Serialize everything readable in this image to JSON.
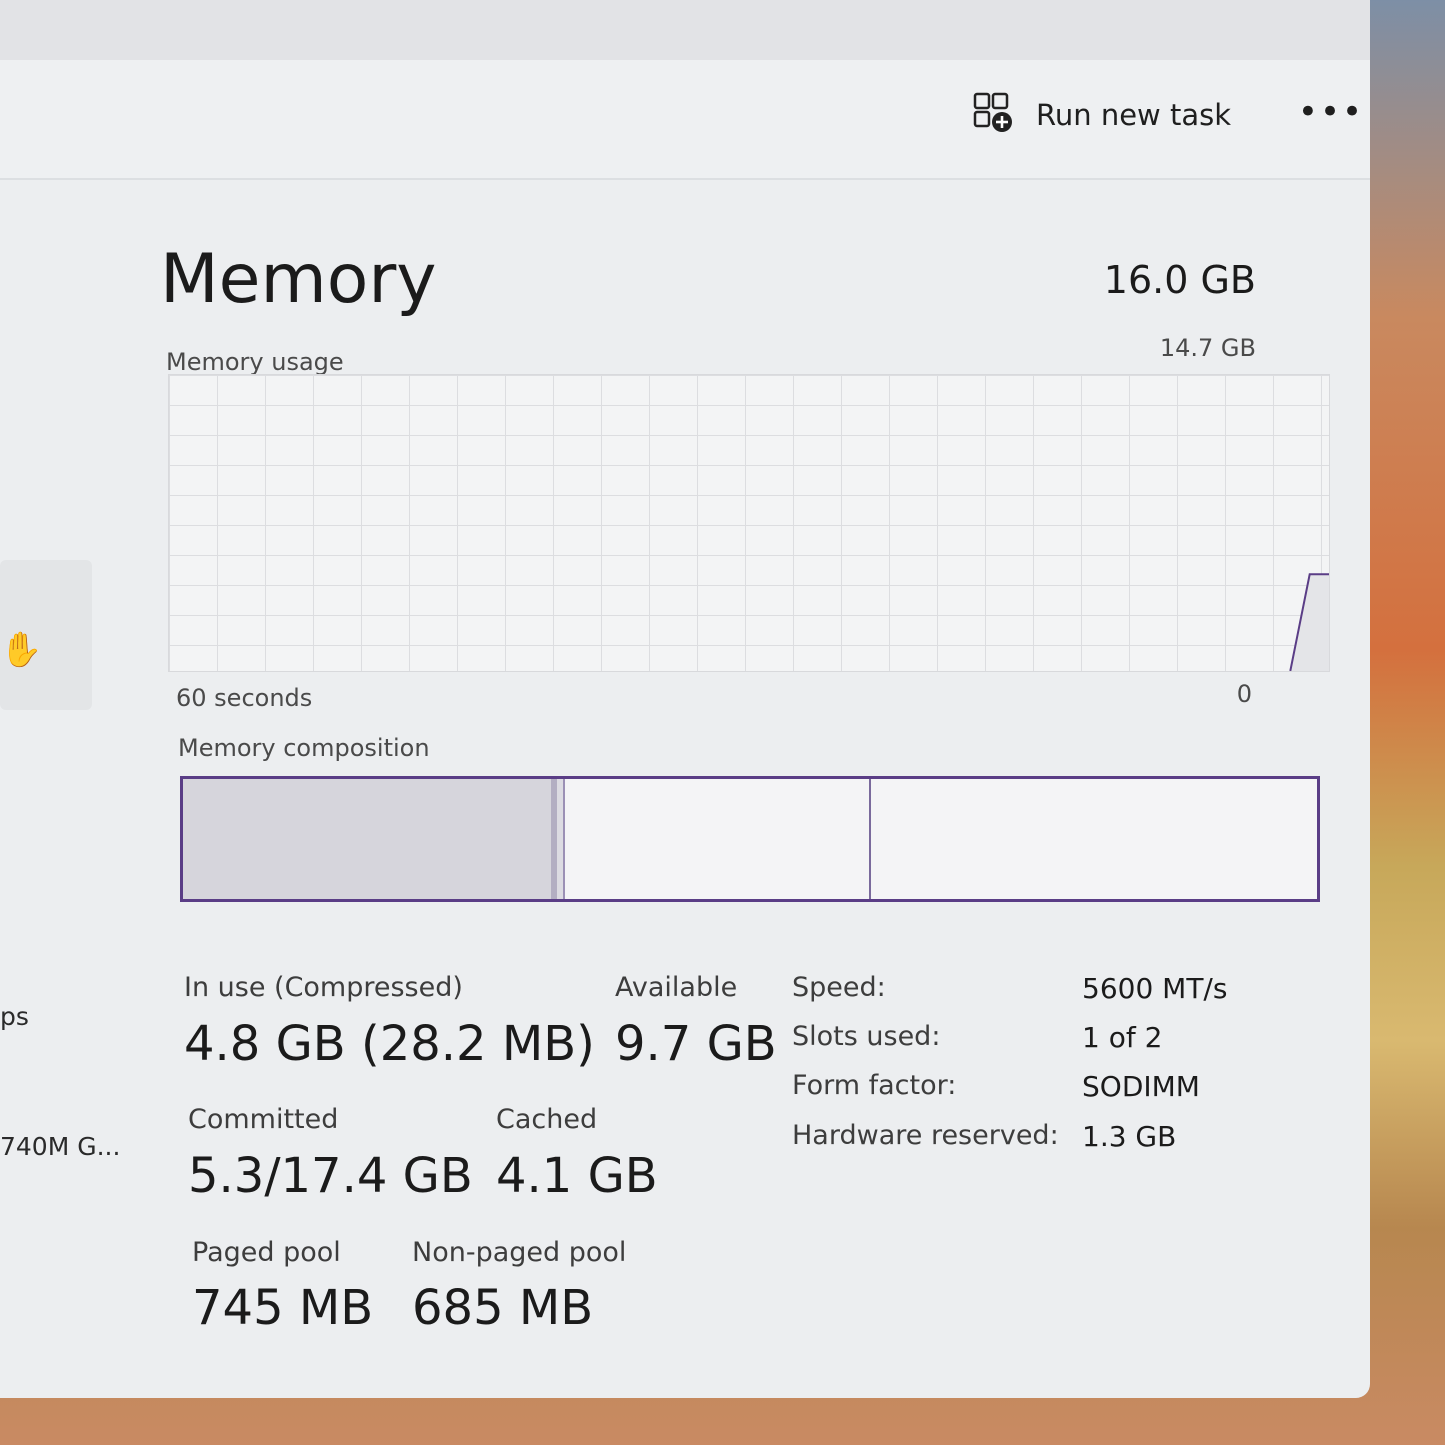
{
  "toolbar": {
    "run_new_task_label": "Run new task",
    "more_label": "•••",
    "run_task_icon": "run-task-icon",
    "more_icon": "more-icon"
  },
  "sidebar": {
    "active_icon": "performance-hand-icon",
    "partial_text_1": "ps",
    "partial_text_2": "740M G..."
  },
  "memory": {
    "title": "Memory",
    "total": "16.0 GB",
    "graph": {
      "label": "Memory usage",
      "max_label": "14.7 GB",
      "time_label": "60 seconds",
      "zero_label": "0",
      "max_gb": 14.7,
      "samples": [
        0,
        0,
        0,
        0,
        0,
        0,
        0,
        0,
        0,
        0,
        0,
        0,
        0,
        0,
        0,
        0,
        0,
        0,
        0,
        0,
        0,
        0,
        0,
        0,
        0,
        0,
        0,
        0,
        0,
        0,
        0,
        0,
        0,
        0,
        0,
        0,
        0,
        0,
        0,
        0,
        0,
        0,
        0,
        0,
        0,
        0,
        0,
        0,
        0,
        0,
        0,
        0,
        0,
        0,
        0,
        0,
        0,
        0,
        0,
        4.8,
        4.8
      ],
      "line_color": "#5a3d86",
      "fill_color": "#e4e5e8"
    },
    "composition": {
      "label": "Memory composition",
      "in_use_fraction": 0.33,
      "modified_fraction": 0.007,
      "standby_fraction": 0.27,
      "border_color": "#5a3d86"
    },
    "stats": {
      "in_use_label": "In use (Compressed)",
      "in_use_value": "4.8 GB (28.2 MB)",
      "available_label": "Available",
      "available_value": "9.7 GB",
      "committed_label": "Committed",
      "committed_value": "5.3/17.4 GB",
      "cached_label": "Cached",
      "cached_value": "4.1 GB",
      "paged_pool_label": "Paged pool",
      "paged_pool_value": "745 MB",
      "non_paged_pool_label": "Non-paged pool",
      "non_paged_pool_value": "685 MB"
    },
    "hardware": {
      "speed_label": "Speed:",
      "speed_value": "5600 MT/s",
      "slots_label": "Slots used:",
      "slots_value": "1 of 2",
      "form_label": "Form factor:",
      "form_value": "SODIMM",
      "reserved_label": "Hardware reserved:",
      "reserved_value": "1.3 GB"
    }
  }
}
